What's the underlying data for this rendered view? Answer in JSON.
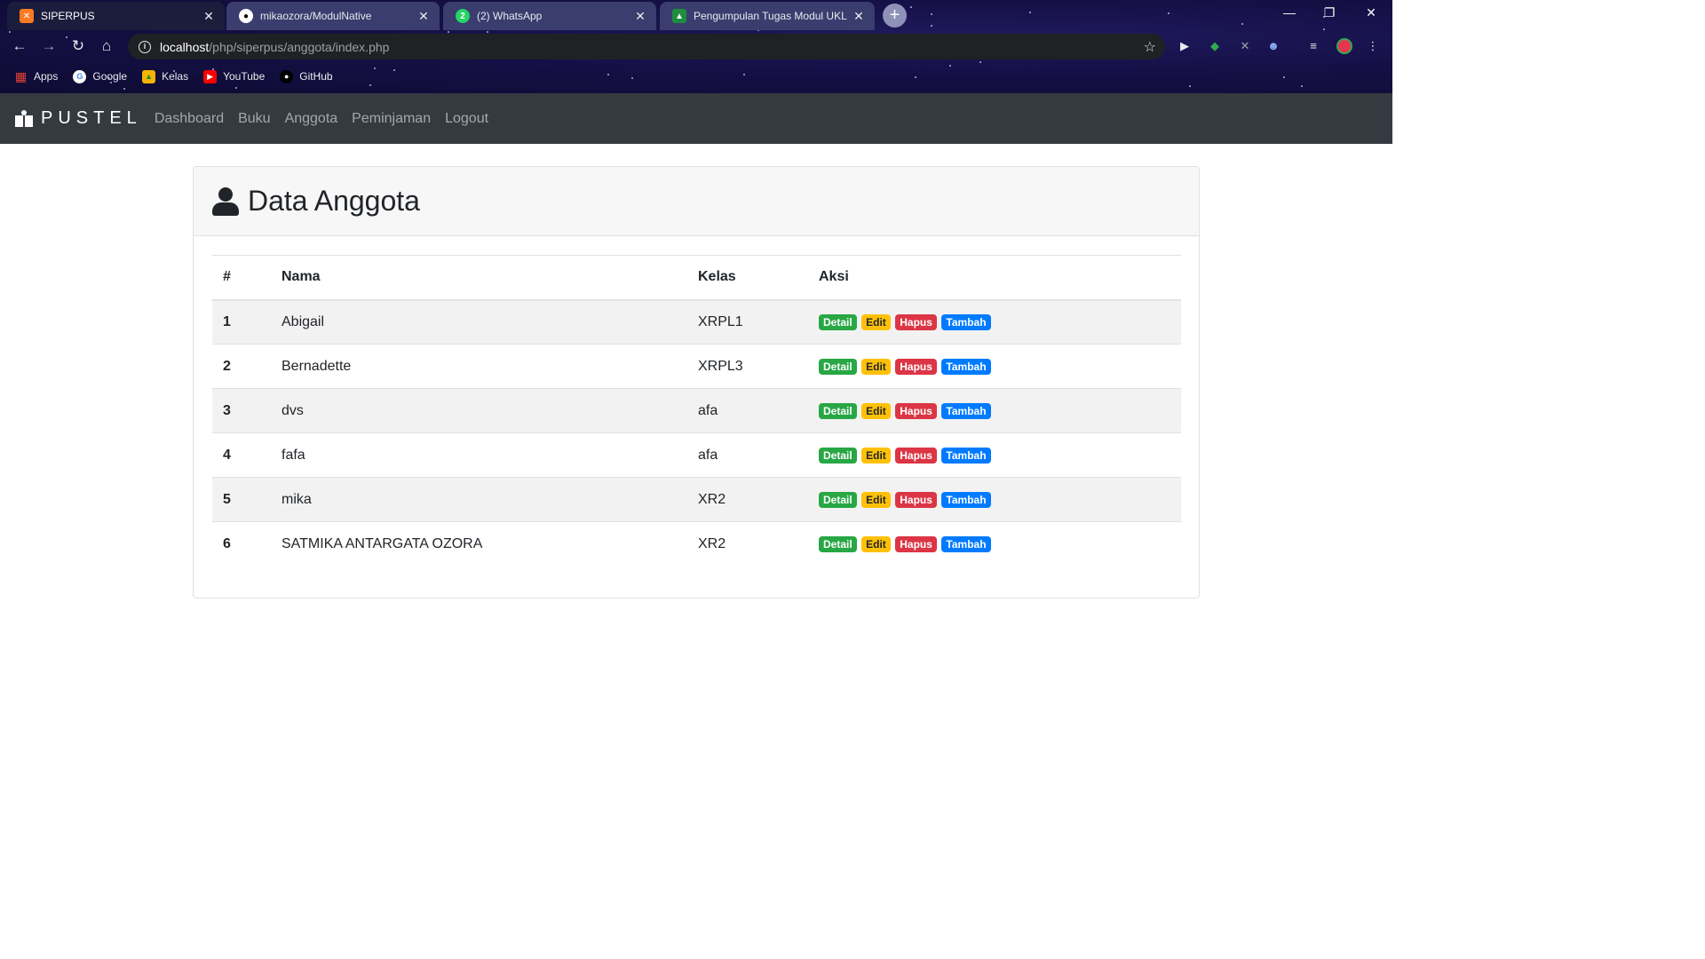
{
  "browser": {
    "tabs": [
      {
        "title": "SIPERPUS",
        "favicon": "xampp-icon"
      },
      {
        "title": "mikaozora/ModulNative",
        "favicon": "github-icon"
      },
      {
        "title": "(2) WhatsApp",
        "favicon": "whatsapp-icon"
      },
      {
        "title": "Pengumpulan Tugas Modul UKL",
        "favicon": "classroom-icon"
      }
    ],
    "url_host": "localhost",
    "url_path": "/php/siperpus/anggota/index.php",
    "bookmarks": [
      {
        "label": "Apps",
        "icon": "apps-grid-icon"
      },
      {
        "label": "Google",
        "icon": "google-icon"
      },
      {
        "label": "Kelas",
        "icon": "classroom-icon"
      },
      {
        "label": "YouTube",
        "icon": "youtube-icon"
      },
      {
        "label": "GitHub",
        "icon": "github-icon"
      }
    ]
  },
  "navbar": {
    "brand": "PUSTEL",
    "links": [
      "Dashboard",
      "Buku",
      "Anggota",
      "Peminjaman",
      "Logout"
    ]
  },
  "card": {
    "title": "Data Anggota",
    "columns": [
      "#",
      "Nama",
      "Kelas",
      "Aksi"
    ],
    "rows": [
      {
        "no": "1",
        "nama": "Abigail",
        "kelas": "XRPL1"
      },
      {
        "no": "2",
        "nama": "Bernadette",
        "kelas": "XRPL3"
      },
      {
        "no": "3",
        "nama": "dvs",
        "kelas": "afa"
      },
      {
        "no": "4",
        "nama": "fafa",
        "kelas": "afa"
      },
      {
        "no": "5",
        "nama": "mika",
        "kelas": "XR2"
      },
      {
        "no": "6",
        "nama": "SATMIKA ANTARGATA OZORA",
        "kelas": "XR2"
      }
    ],
    "actions": {
      "detail": "Detail",
      "edit": "Edit",
      "hapus": "Hapus",
      "tambah": "Tambah"
    }
  },
  "colors": {
    "navbar": "#343a40",
    "detail": "#28a745",
    "edit": "#ffc107",
    "hapus": "#dc3545",
    "tambah": "#007bff"
  }
}
